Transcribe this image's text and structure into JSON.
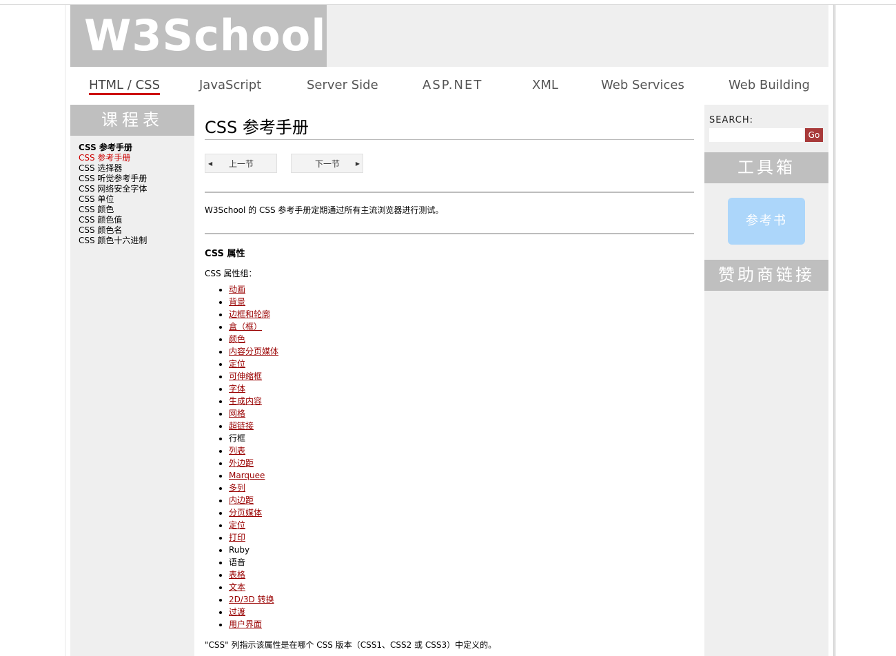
{
  "header": {
    "logo": "W3School"
  },
  "nav": [
    {
      "label": "HTML / CSS",
      "active": true
    },
    {
      "label": "JavaScript"
    },
    {
      "label": "Server Side"
    },
    {
      "label": "ASP.NET"
    },
    {
      "label": "XML"
    },
    {
      "label": "Web Services"
    },
    {
      "label": "Web Building"
    }
  ],
  "left": {
    "title": "课程表",
    "items": [
      "CSS 参考手册",
      "CSS 参考手册",
      "CSS 选择器",
      "CSS 听觉参考手册",
      "CSS 网络安全字体",
      "CSS 单位",
      "CSS 颜色",
      "CSS 颜色值",
      "CSS 颜色名",
      "CSS 颜色十六进制"
    ]
  },
  "main": {
    "title": "CSS 参考手册",
    "prev": "上一节",
    "next": "下一节",
    "intro": "W3School 的 CSS 参考手册定期通过所有主流浏览器进行测试。",
    "section_title": "CSS 属性",
    "group_label": "CSS 属性组：",
    "properties": [
      {
        "label": "动画",
        "link": true
      },
      {
        "label": "背景",
        "link": true
      },
      {
        "label": "边框和轮廓",
        "link": true
      },
      {
        "label": "盒（框）",
        "link": true
      },
      {
        "label": "颜色",
        "link": true
      },
      {
        "label": "内容分页媒体",
        "link": true
      },
      {
        "label": "定位",
        "link": true
      },
      {
        "label": "可伸缩框",
        "link": true
      },
      {
        "label": "字体",
        "link": true
      },
      {
        "label": "生成内容",
        "link": true
      },
      {
        "label": "网格",
        "link": true
      },
      {
        "label": "超链接",
        "link": true
      },
      {
        "label": "行框",
        "link": false
      },
      {
        "label": "列表",
        "link": true
      },
      {
        "label": "外边距",
        "link": true
      },
      {
        "label": "Marquee",
        "link": true
      },
      {
        "label": "多列",
        "link": true
      },
      {
        "label": "内边距",
        "link": true
      },
      {
        "label": "分页媒体",
        "link": true
      },
      {
        "label": "定位",
        "link": true
      },
      {
        "label": "打印",
        "link": true
      },
      {
        "label": "Ruby",
        "link": false
      },
      {
        "label": "语音",
        "link": false
      },
      {
        "label": "表格",
        "link": true
      },
      {
        "label": "文本",
        "link": true
      },
      {
        "label": "2D/3D 转换",
        "link": true
      },
      {
        "label": "过渡",
        "link": true
      },
      {
        "label": "用户界面",
        "link": true
      }
    ],
    "footnote": "\"CSS\" 列指示该属性是在哪个 CSS 版本（CSS1、CSS2 或 CSS3）中定义的。"
  },
  "right": {
    "search_label": "SEARCH:",
    "search_value": "",
    "go_label": "Go",
    "toolbox_title": "工具箱",
    "reference_button": "参考书",
    "sponsor_title": "赞助商链接"
  },
  "colors": {
    "accent_red": "#cc0000",
    "link": "#990000",
    "panel_gray": "#efefef",
    "header_gray": "#bfbfbf",
    "ref_button": "#acd6fa"
  }
}
